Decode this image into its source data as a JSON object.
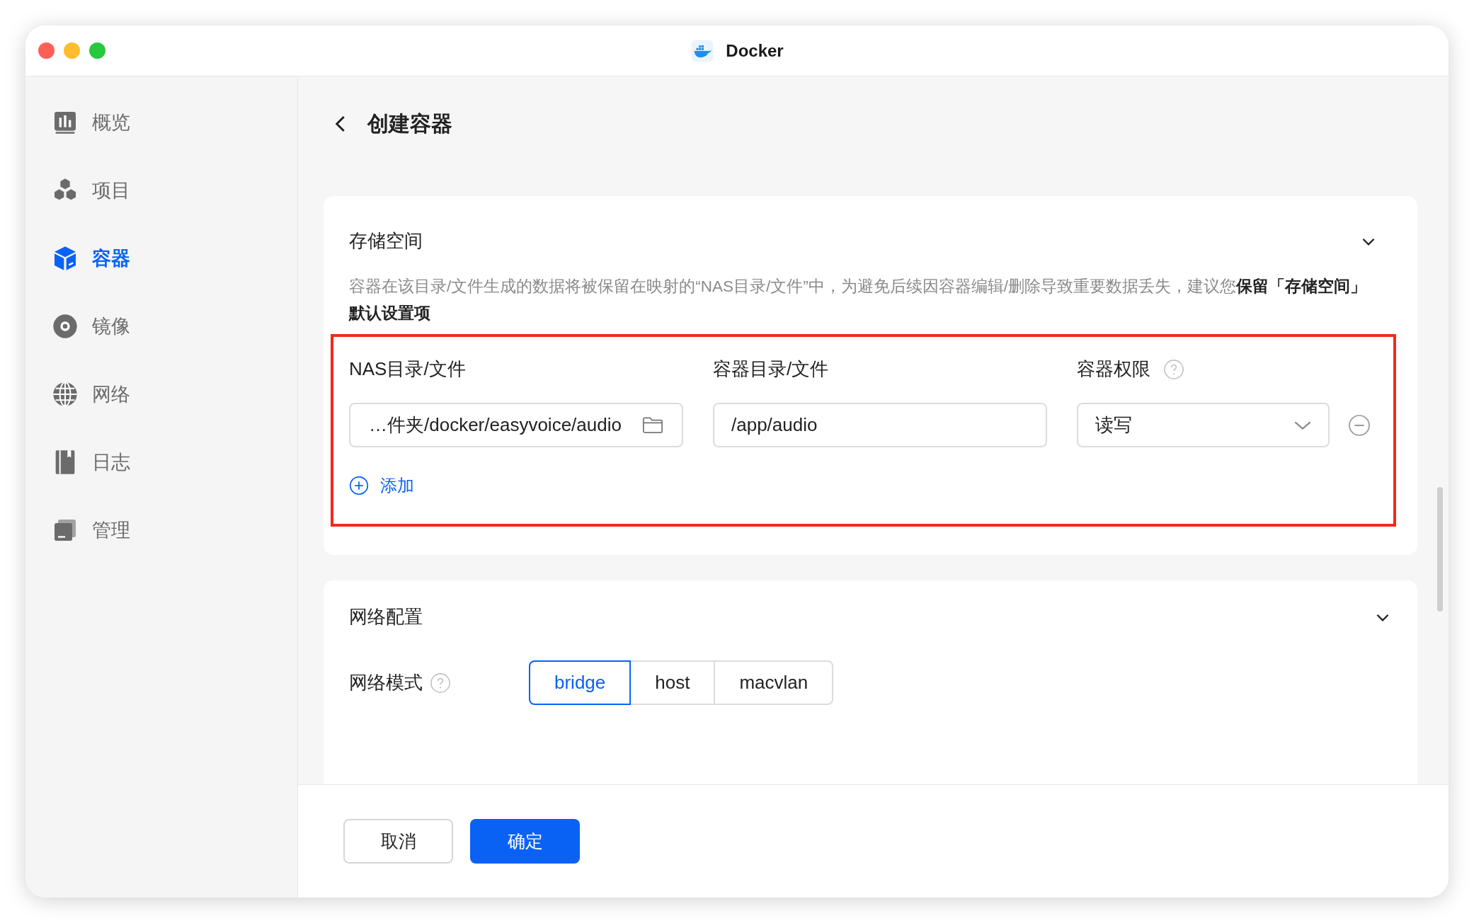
{
  "window": {
    "title": "Docker"
  },
  "sidebar": {
    "items": [
      {
        "label": "概览",
        "selected": false
      },
      {
        "label": "项目",
        "selected": false
      },
      {
        "label": "容器",
        "selected": true
      },
      {
        "label": "镜像",
        "selected": false
      },
      {
        "label": "网络",
        "selected": false
      },
      {
        "label": "日志",
        "selected": false
      },
      {
        "label": "管理",
        "selected": false
      }
    ]
  },
  "page": {
    "title": "创建容器"
  },
  "storage": {
    "title": "存储空间",
    "expanded": true,
    "description": "容器在该目录/文件生成的数据将被保留在映射的“NAS目录/文件”中，为避免后续因容器编辑/删除导致重要数据丢失，建议您**保留「存储空间」默认设置项**",
    "columns": [
      "NAS目录/文件",
      "容器目录/文件",
      "容器权限"
    ],
    "rows": [
      {
        "nas_path": "…件夹/docker/easyvoice/audio",
        "container_path": "/app/audio",
        "permission": "读写"
      }
    ],
    "add_label": "添加"
  },
  "network": {
    "title": "网络配置",
    "expanded": true,
    "mode_label": "网络模式",
    "modes": [
      {
        "label": "bridge",
        "selected": true
      },
      {
        "label": "host",
        "selected": false
      },
      {
        "label": "macvlan",
        "selected": false
      }
    ]
  },
  "footer": {
    "cancel": "取消",
    "confirm": "确定"
  }
}
